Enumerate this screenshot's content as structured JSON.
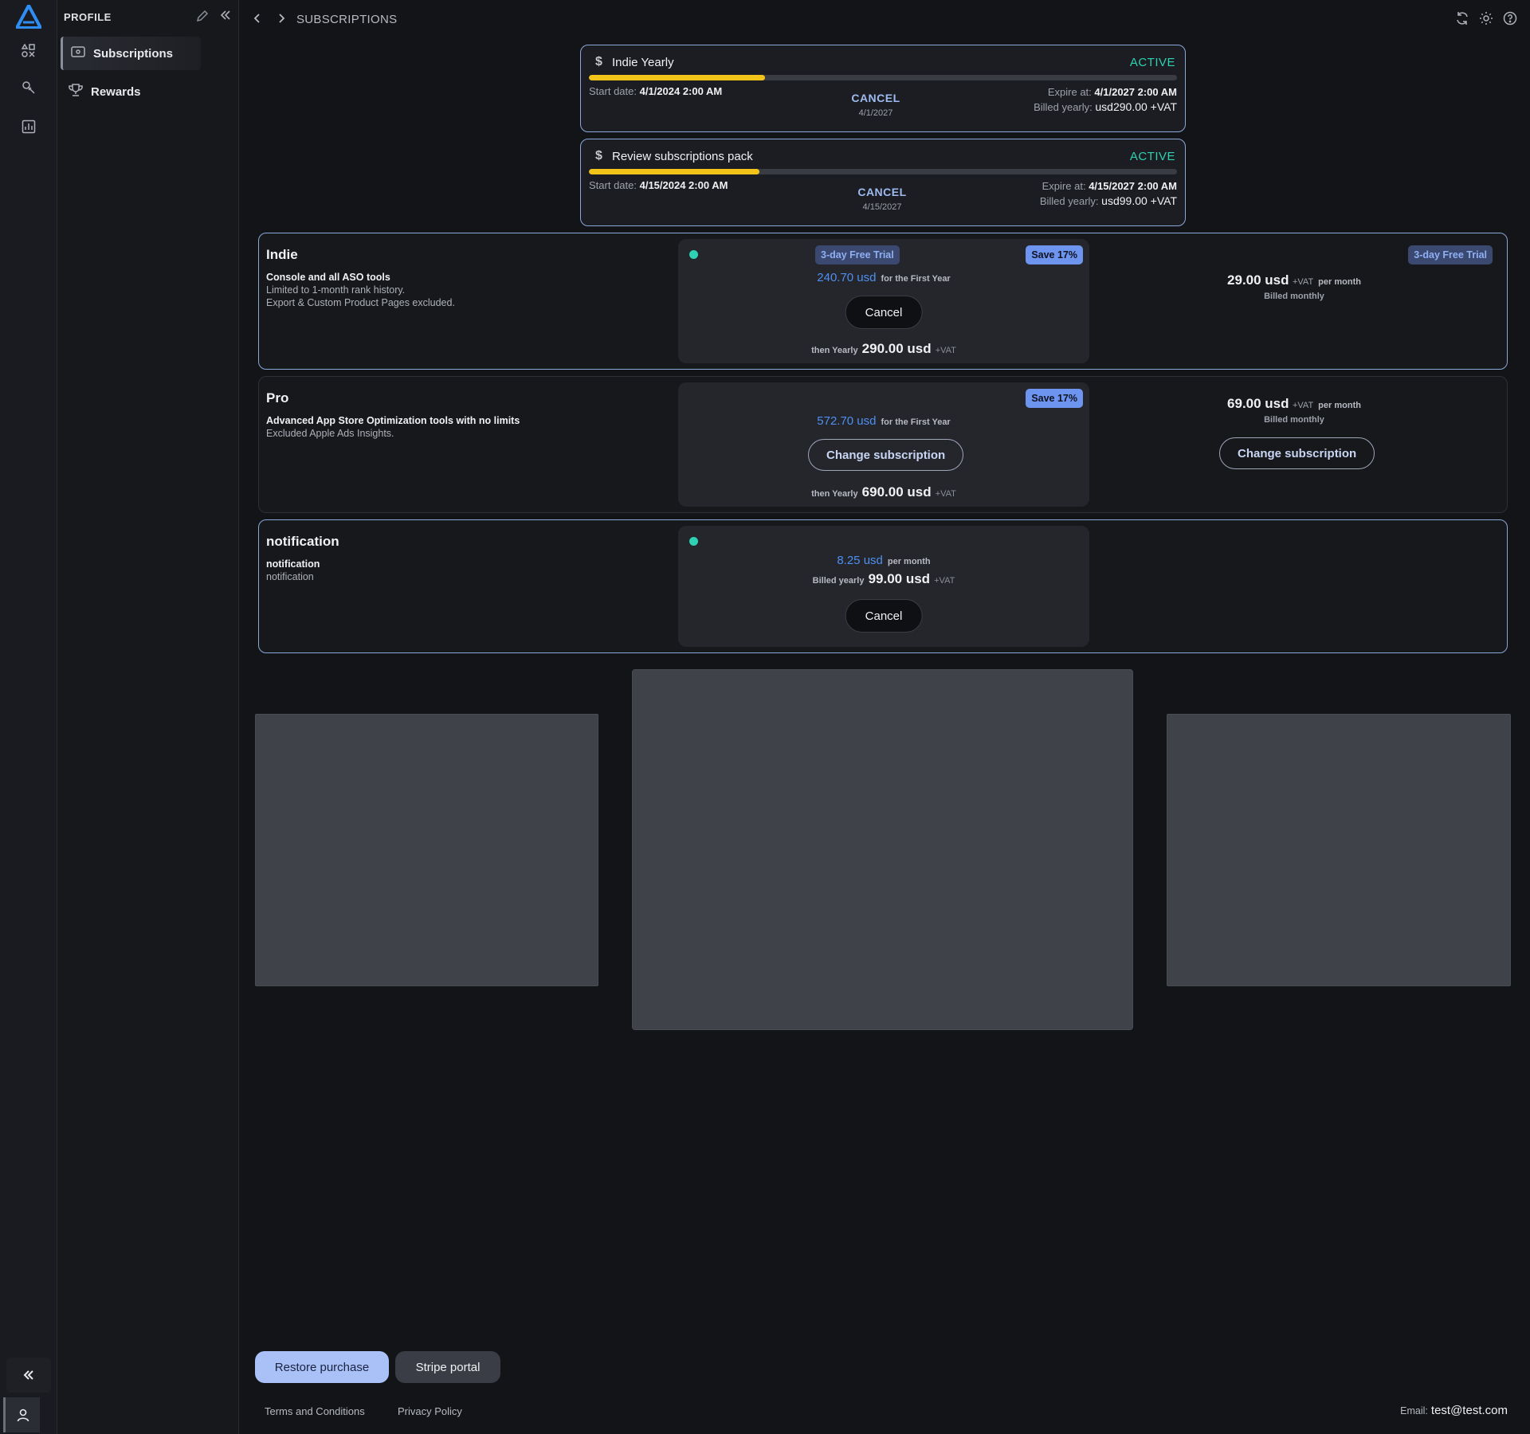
{
  "sidebar": {
    "title": "PROFILE",
    "items": [
      {
        "label": "Subscriptions",
        "icon": "ticket-icon"
      },
      {
        "label": "Rewards",
        "icon": "trophy-icon"
      }
    ]
  },
  "header": {
    "breadcrumb": "SUBSCRIPTIONS"
  },
  "active_subscriptions": [
    {
      "name": "Indie Yearly",
      "status": "ACTIVE",
      "progress_fraction": 0.3,
      "start_label": "Start date:",
      "start_value": "4/1/2024 2:00 AM",
      "cancel_label": "CANCEL",
      "cancel_date": "4/1/2027",
      "expire_label": "Expire at:",
      "expire_value": "4/1/2027 2:00 AM",
      "billed_label": "Billed yearly:",
      "billed_value": "usd290.00 +VAT"
    },
    {
      "name": "Review subscriptions pack",
      "status": "ACTIVE",
      "progress_fraction": 0.29,
      "start_label": "Start date:",
      "start_value": "4/15/2024 2:00 AM",
      "cancel_label": "CANCEL",
      "cancel_date": "4/15/2027",
      "expire_label": "Expire at:",
      "expire_value": "4/15/2027 2:00 AM",
      "billed_label": "Billed yearly:",
      "billed_value": "usd99.00 +VAT"
    }
  ],
  "plans": [
    {
      "title": "Indie",
      "desc1": "Console and all ASO tools",
      "desc2": "Limited to 1-month rank history.",
      "desc3": "Export & Custom Product Pages excluded.",
      "yearly": {
        "trial_badge": "3-day Free Trial",
        "save_badge": "Save 17%",
        "first_price": "240.70 usd",
        "first_suffix": "for the First Year",
        "button": "Cancel",
        "then_prefix": "then Yearly",
        "then_amount": "290.00 usd",
        "then_vat": "+VAT"
      },
      "monthly": {
        "trial_badge": "3-day Free Trial",
        "amount": "29.00 usd",
        "vat": "+VAT",
        "per": "per month",
        "billed": "Billed monthly"
      }
    },
    {
      "title": "Pro",
      "desc1": "Advanced App Store Optimization tools with no limits",
      "desc2": "Excluded Apple Ads Insights.",
      "yearly": {
        "save_badge": "Save 17%",
        "first_price": "572.70 usd",
        "first_suffix": "for the First Year",
        "button": "Change subscription",
        "then_prefix": "then Yearly",
        "then_amount": "690.00 usd",
        "then_vat": "+VAT"
      },
      "monthly": {
        "amount": "69.00 usd",
        "vat": "+VAT",
        "per": "per month",
        "billed": "Billed monthly",
        "button": "Change subscription"
      }
    },
    {
      "title": "notification",
      "desc1": "notification",
      "desc2": "notification",
      "yearly": {
        "price": "8.25 usd",
        "per": "per month",
        "billed_prefix": "Billed yearly",
        "billed_amount": "99.00 usd",
        "billed_vat": "+VAT",
        "button": "Cancel"
      }
    }
  ],
  "actions": {
    "restore": "Restore purchase",
    "stripe": "Stripe portal"
  },
  "footer": {
    "terms": "Terms and Conditions",
    "privacy": "Privacy Policy",
    "email_label": "Email:",
    "email_value": "test@test.com"
  },
  "colors": {
    "accent_blue": "#4f8ff0",
    "active_green": "#2fd1b3",
    "progress_yellow": "#f2c318",
    "primary_button": "#a9c1f7"
  }
}
